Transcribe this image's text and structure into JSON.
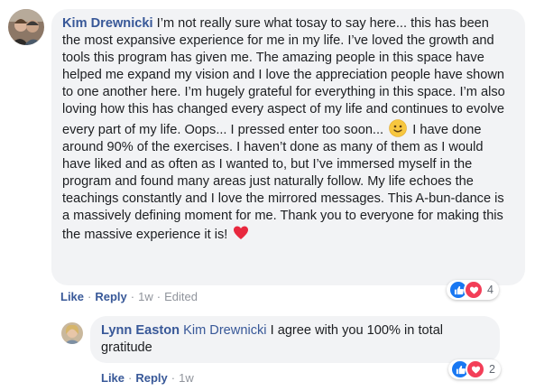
{
  "comments": [
    {
      "author": "Kim Drewnicki",
      "text_part1": "I’m not really sure what tosay to say here... this has been the most expansive experience for me in my life. I’ve loved the growth and tools this program has given me. The amazing people in this space have helped me expand my vision and I love the appreciation people have shown to one another here. I’m hugely grateful for everything in this space. I’m also loving how this has changed every aspect of my life and continues to evolve every part of my life. Oops... I pressed enter too soon...",
      "text_part2": "I have done around 90% of the exercises. I haven’t done as many of them as I would have liked and as often as I wanted to, but I’ve immersed myself in the program and found many areas just naturally follow. My life echoes the teachings constantly and I love the mirrored messages. This A-bun-dance is a massively defining moment for me. Thank you to everyone for making this the massive experience it is!",
      "inline_icons": [
        "slightly-smiling-face-emoji",
        "red-heart-emoji"
      ],
      "actions": {
        "like": "Like",
        "reply": "Reply",
        "time": "1w",
        "edited": "Edited"
      },
      "reactions": {
        "icons": [
          "like-reaction",
          "love-reaction"
        ],
        "count": "4"
      }
    },
    {
      "author": "Lynn Easton",
      "mention": "Kim Drewnicki",
      "text": "I agree with you 100% in total gratitude",
      "actions": {
        "like": "Like",
        "reply": "Reply",
        "time": "1w"
      },
      "reactions": {
        "icons": [
          "like-reaction",
          "love-reaction"
        ],
        "count": "2"
      }
    }
  ],
  "colors": {
    "link": "#385898",
    "bubble": "#f2f3f5",
    "like": "#1877f2",
    "love": "#f33e58"
  }
}
